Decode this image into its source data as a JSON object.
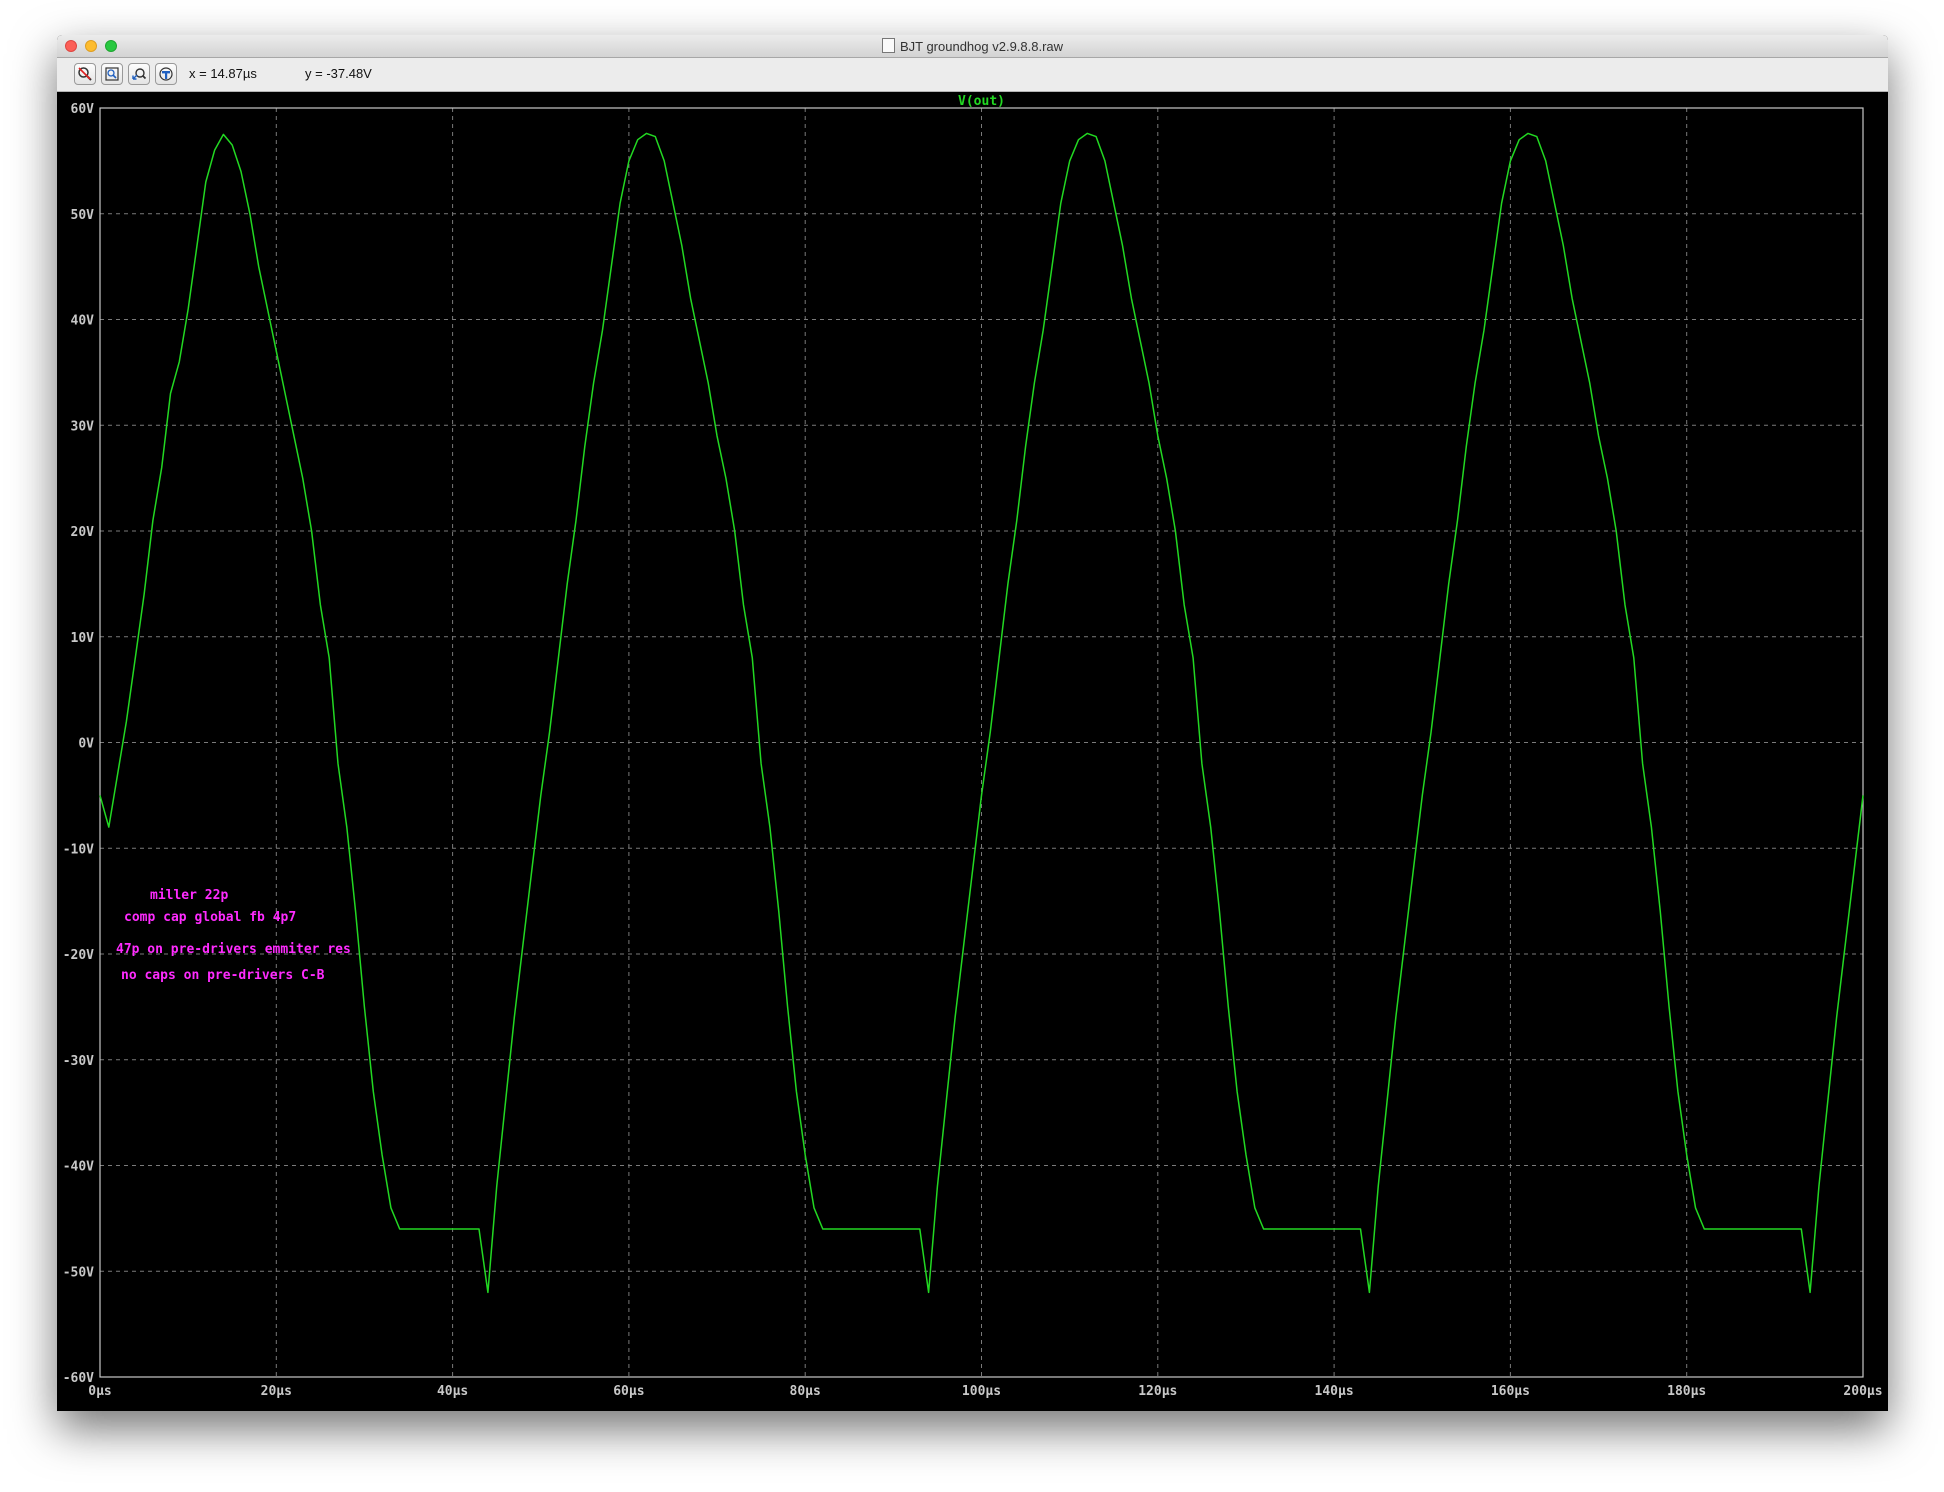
{
  "window": {
    "title": "BJT groundhog v2.9.8.8.raw"
  },
  "toolbar": {
    "tools": [
      {
        "name": "zoom-cancel-icon"
      },
      {
        "name": "zoom-extents-icon"
      },
      {
        "name": "zoom-back-icon"
      },
      {
        "name": "cursor-probe-icon"
      }
    ],
    "cursor_x": "x = 14.87µs",
    "cursor_y": "y = -37.48V"
  },
  "annotations": [
    "miller 22p",
    "comp cap global fb 4p7",
    "47p on pre-drivers emmiter res",
    "no caps on pre-drivers C-B"
  ],
  "colors": {
    "plot_background": "#000000",
    "grid": "#7a7a7a",
    "trace": "#22d822",
    "annotation": "#ff2bff",
    "tick_label": "#c8c8c8"
  },
  "chart_data": {
    "type": "line",
    "title": "V(out)",
    "series": [
      {
        "name": "V(out)",
        "x": [
          0,
          1,
          2,
          3,
          4,
          5,
          6,
          7,
          8,
          9,
          10,
          11,
          12,
          13,
          14,
          15,
          16,
          17,
          18,
          19,
          20,
          21,
          22,
          23,
          24,
          25,
          26,
          27,
          28,
          29,
          30,
          31,
          32,
          33,
          34,
          35,
          36,
          37,
          38,
          39,
          40,
          41,
          42,
          43,
          44,
          45,
          46,
          47,
          48,
          49,
          50,
          51,
          52,
          53,
          54,
          55,
          56,
          57,
          58,
          59,
          60,
          61,
          62,
          63,
          64,
          65,
          66,
          67,
          68,
          69,
          70,
          71,
          72,
          73,
          74,
          75,
          76,
          77,
          78,
          79,
          80,
          81,
          82,
          83,
          84,
          85,
          86,
          87,
          88,
          89,
          90,
          91,
          92,
          93,
          94,
          95,
          96,
          97,
          98,
          99,
          100,
          101,
          102,
          103,
          104,
          105,
          106,
          107,
          108,
          109,
          110,
          111,
          112,
          113,
          114,
          115,
          116,
          117,
          118,
          119,
          120,
          121,
          122,
          123,
          124,
          125,
          126,
          127,
          128,
          129,
          130,
          131,
          132,
          133,
          134,
          135,
          136,
          137,
          138,
          139,
          140,
          141,
          142,
          143,
          144,
          145,
          146,
          147,
          148,
          149,
          150,
          151,
          152,
          153,
          154,
          155,
          156,
          157,
          158,
          159,
          160,
          161,
          162,
          163,
          164,
          165,
          166,
          167,
          168,
          169,
          170,
          171,
          172,
          173,
          174,
          175,
          176,
          177,
          178,
          179,
          180,
          181,
          182,
          183,
          184,
          185,
          186,
          187,
          188,
          189,
          190,
          191,
          192,
          193,
          194,
          195,
          196,
          197,
          198,
          199,
          200
        ],
        "y": [
          -5,
          -8,
          -3,
          2,
          8,
          14,
          21,
          26,
          33,
          36,
          41,
          47,
          53,
          56,
          57.5,
          56.5,
          54,
          50,
          45,
          41,
          37,
          33,
          29,
          25,
          20,
          13,
          8,
          -2,
          -8,
          -16,
          -25,
          -33,
          -39,
          -44,
          -46,
          -46,
          -46,
          -46,
          -46,
          -46,
          -46,
          -46,
          -46,
          -46,
          -52,
          -42,
          -34,
          -26,
          -19,
          -12,
          -5,
          1,
          8,
          15,
          21,
          28,
          34,
          39,
          45,
          51,
          55,
          57,
          57.6,
          57.3,
          55,
          51,
          47,
          42,
          38,
          34,
          29,
          25,
          20,
          13,
          8,
          -2,
          -8,
          -16,
          -25,
          -33,
          -39,
          -44,
          -46,
          -46,
          -46,
          -46,
          -46,
          -46,
          -46,
          -46,
          -46,
          -46,
          -46,
          -46,
          -52,
          -42,
          -34,
          -26,
          -19,
          -12,
          -5,
          1,
          8,
          15,
          21,
          28,
          34,
          39,
          45,
          51,
          55,
          57,
          57.6,
          57.3,
          55,
          51,
          47,
          42,
          38,
          34,
          29,
          25,
          20,
          13,
          8,
          -2,
          -8,
          -16,
          -25,
          -33,
          -39,
          -44,
          -46,
          -46,
          -46,
          -46,
          -46,
          -46,
          -46,
          -46,
          -46,
          -46,
          -46,
          -46,
          -52,
          -42,
          -34,
          -26,
          -19,
          -12,
          -5,
          1,
          8,
          15,
          21,
          28,
          34,
          39,
          45,
          51,
          55,
          57,
          57.6,
          57.3,
          55,
          51,
          47,
          42,
          38,
          34,
          29,
          25,
          20,
          13,
          8,
          -2,
          -8,
          -16,
          -25,
          -33,
          -39,
          -44,
          -46,
          -46,
          -46,
          -46,
          -46,
          -46,
          -46,
          -46,
          -46,
          -46,
          -46,
          -46,
          -52,
          -42,
          -34,
          -26,
          -19,
          -12,
          -5
        ]
      }
    ],
    "xlim": [
      0,
      200
    ],
    "ylim": [
      -60,
      60
    ],
    "x_ticks": [
      0,
      20,
      40,
      60,
      80,
      100,
      120,
      140,
      160,
      180,
      200
    ],
    "x_tick_labels": [
      "0µs",
      "20µs",
      "40µs",
      "60µs",
      "80µs",
      "100µs",
      "120µs",
      "140µs",
      "160µs",
      "180µs",
      "200µs"
    ],
    "y_ticks": [
      60,
      50,
      40,
      30,
      20,
      10,
      0,
      -10,
      -20,
      -30,
      -40,
      -50,
      -60
    ],
    "y_tick_labels": [
      "60V",
      "50V",
      "40V",
      "30V",
      "20V",
      "10V",
      "0V",
      "-10V",
      "-20V",
      "-30V",
      "-40V",
      "-50V",
      "-60V"
    ],
    "grid": true
  }
}
